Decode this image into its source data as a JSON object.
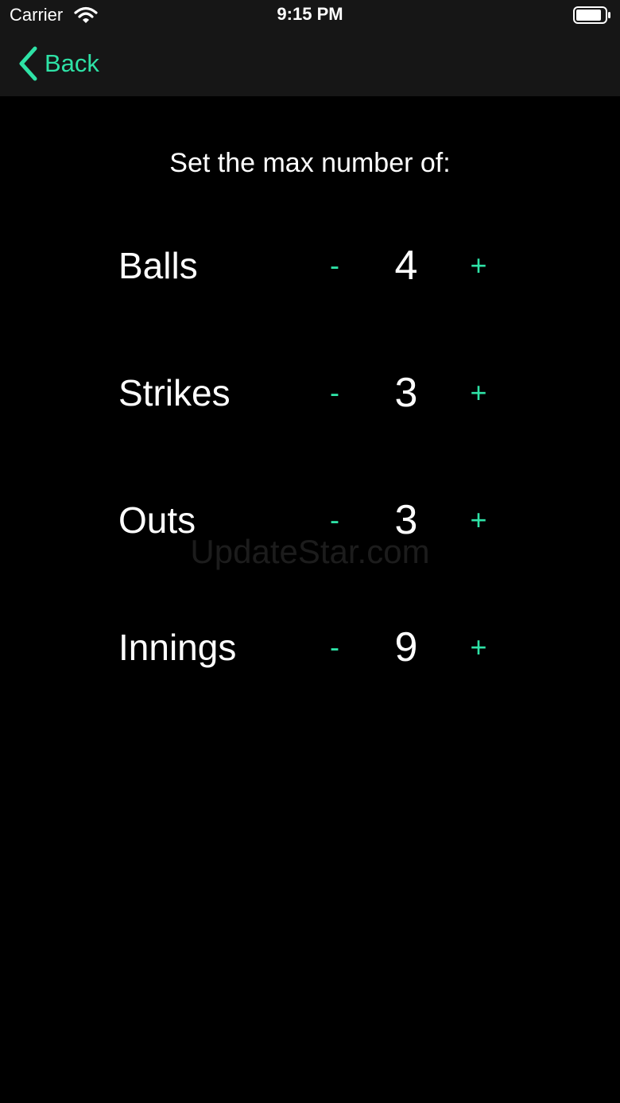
{
  "status_bar": {
    "carrier": "Carrier",
    "time": "9:15 PM"
  },
  "nav": {
    "back_label": "Back"
  },
  "heading": "Set the max number of:",
  "settings": [
    {
      "label": "Balls",
      "value": "4",
      "decrement": "-",
      "increment": "+"
    },
    {
      "label": "Strikes",
      "value": "3",
      "decrement": "-",
      "increment": "+"
    },
    {
      "label": "Outs",
      "value": "3",
      "decrement": "-",
      "increment": "+"
    },
    {
      "label": "Innings",
      "value": "9",
      "decrement": "-",
      "increment": "+"
    }
  ],
  "watermark": "UpdateStar.com",
  "colors": {
    "accent": "#2ee2a6",
    "background": "#000000",
    "nav_background": "#161616",
    "text": "#ffffff"
  },
  "icons": {
    "wifi": "wifi-icon",
    "battery": "battery-icon",
    "back": "chevron-left-icon"
  }
}
